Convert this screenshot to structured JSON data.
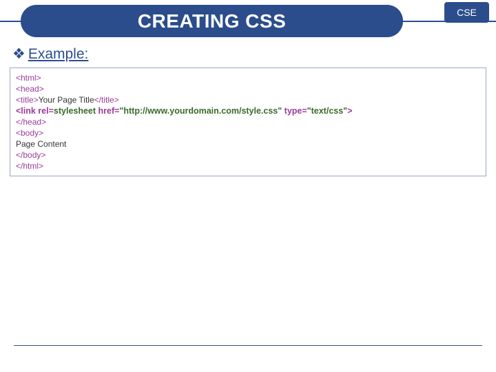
{
  "header": {
    "title": "CREATING CSS",
    "badge": "CSE"
  },
  "example": {
    "label": "Example:",
    "bullet": "❖",
    "lines": [
      {
        "bold": false,
        "segments": [
          {
            "cls": "tag",
            "t": "<html>"
          }
        ]
      },
      {
        "bold": false,
        "segments": [
          {
            "cls": "tag",
            "t": "<head>"
          }
        ]
      },
      {
        "bold": false,
        "segments": [
          {
            "cls": "tag",
            "t": "<title>"
          },
          {
            "cls": "text",
            "t": "Your Page Title"
          },
          {
            "cls": "tag",
            "t": "</title>"
          }
        ]
      },
      {
        "bold": true,
        "segments": [
          {
            "cls": "tag",
            "t": "<link rel="
          },
          {
            "cls": "attrval",
            "t": "stylesheet "
          },
          {
            "cls": "tag",
            "t": "href="
          },
          {
            "cls": "attrval",
            "t": "\"http://www.yourdomain.com/style.css\" "
          },
          {
            "cls": "tag",
            "t": "type="
          },
          {
            "cls": "attrval",
            "t": "\"text/css\""
          },
          {
            "cls": "tag",
            "t": ">"
          }
        ]
      },
      {
        "bold": false,
        "segments": [
          {
            "cls": "tag",
            "t": "</head>"
          }
        ]
      },
      {
        "bold": false,
        "segments": [
          {
            "cls": "tag",
            "t": "<body>"
          }
        ]
      },
      {
        "bold": false,
        "segments": [
          {
            "cls": "text",
            "t": "Page Content"
          }
        ]
      },
      {
        "bold": false,
        "segments": [
          {
            "cls": "tag",
            "t": "</body>"
          }
        ]
      },
      {
        "bold": false,
        "segments": [
          {
            "cls": "tag",
            "t": "</html>"
          }
        ]
      }
    ]
  }
}
